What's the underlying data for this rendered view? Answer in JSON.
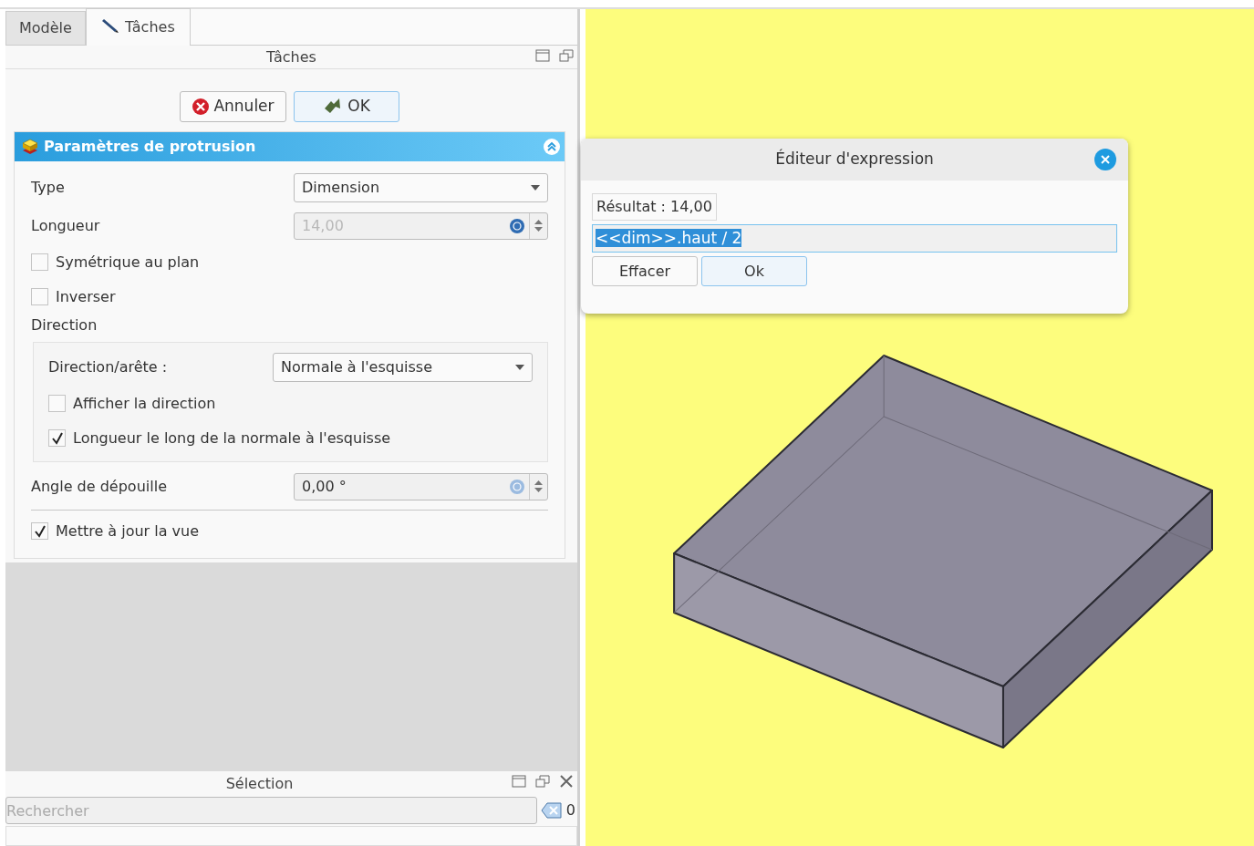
{
  "tabs": [
    {
      "label": "Modèle",
      "selected": false
    },
    {
      "label": "Tâches",
      "selected": true
    }
  ],
  "task_panel": {
    "title": "Tâches",
    "buttons": [
      {
        "label": "Annuler",
        "kind": "cancel"
      },
      {
        "label": "OK",
        "kind": "ok"
      }
    ]
  },
  "protrusion": {
    "title": "Paramètres de protrusion",
    "expanded": true,
    "type": {
      "label": "Type",
      "value": "Dimension"
    },
    "length": {
      "label": "Longueur",
      "value": "14,00",
      "disabled": true
    },
    "options": [
      {
        "label": "Symétrique au plan",
        "checked": false
      },
      {
        "label": "Inverser",
        "checked": false
      }
    ],
    "direction": {
      "heading": "Direction",
      "edge_label": "Direction/arête :",
      "edge_value": "Normale à l'esquisse",
      "options": [
        {
          "label": "Afficher la direction",
          "checked": false
        },
        {
          "label": "Longueur le long de la normale à l'esquisse",
          "checked": true
        }
      ]
    },
    "taper": {
      "label": "Angle de dépouille",
      "value": "0,00 °",
      "disabled": false
    },
    "update_view": {
      "label": "Mettre à jour la vue",
      "checked": true
    }
  },
  "selection_panel": {
    "title": "Sélection",
    "search": {
      "placeholder": "Rechercher"
    },
    "count": "0"
  },
  "expression_dialog": {
    "title": "Éditeur d'expression",
    "result": "Résultat : 14,00",
    "expression": "<<dim>>.haut / 2",
    "buttons": [
      {
        "label": "Effacer"
      },
      {
        "label": "Ok"
      }
    ]
  }
}
